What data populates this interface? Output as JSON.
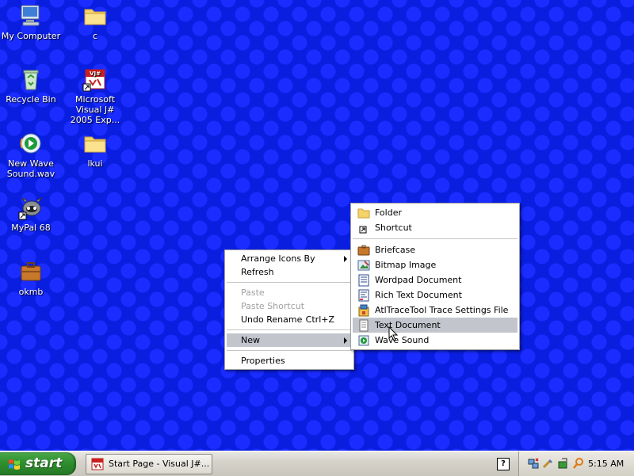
{
  "desktop": {
    "icons": [
      {
        "label": "My Computer",
        "icon": "computer-icon"
      },
      {
        "label": "c",
        "icon": "folder-icon"
      },
      {
        "label": "Recycle Bin",
        "icon": "recycle-bin-icon"
      },
      {
        "label": "Microsoft Visual J# 2005 Exp...",
        "icon": "vjsharp-icon"
      },
      {
        "label": "New Wave Sound.wav",
        "icon": "media-player-icon"
      },
      {
        "label": "lkui",
        "icon": "folder-icon"
      },
      {
        "label": "MyPal 68",
        "icon": "mypal-icon"
      },
      {
        "label": "okmb",
        "icon": "briefcase-icon"
      }
    ]
  },
  "context_menu": {
    "items": [
      {
        "label": "Arrange Icons By",
        "submenu": true
      },
      {
        "label": "Refresh"
      },
      {
        "label": "Paste",
        "disabled": true
      },
      {
        "label": "Paste Shortcut",
        "disabled": true
      },
      {
        "label": "Undo Rename",
        "accelerator": "Ctrl+Z"
      },
      {
        "label": "New",
        "submenu": true,
        "highlighted": true
      },
      {
        "label": "Properties"
      }
    ]
  },
  "new_submenu": {
    "items": [
      {
        "label": "Folder",
        "icon": "folder-icon"
      },
      {
        "label": "Shortcut",
        "icon": "shortcut-icon"
      },
      {
        "label": "Briefcase",
        "icon": "briefcase-icon"
      },
      {
        "label": "Bitmap Image",
        "icon": "bitmap-icon"
      },
      {
        "label": "Wordpad Document",
        "icon": "wordpad-icon"
      },
      {
        "label": "Rich Text Document",
        "icon": "rich-text-icon"
      },
      {
        "label": "AtlTraceTool Trace Settings File",
        "icon": "trace-settings-icon"
      },
      {
        "label": "Text Document",
        "icon": "text-document-icon",
        "highlighted": true
      },
      {
        "label": "Wave Sound",
        "icon": "wave-sound-icon"
      }
    ]
  },
  "taskbar": {
    "start_label": "start",
    "task_button_label": "Start Page - Visual J#...",
    "help_label": "?",
    "clock": "5:15 AM"
  },
  "colors": {
    "desktop_background": "#0a1ee0",
    "menu_highlight": "#c2c5cc",
    "start_button": "#2f8f2f"
  }
}
